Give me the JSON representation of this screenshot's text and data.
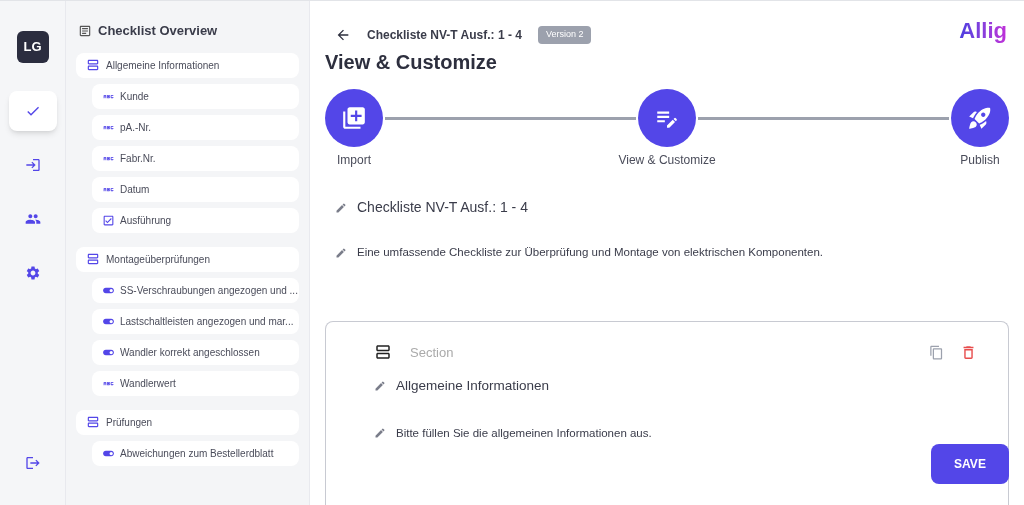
{
  "rail": {
    "avatar": "LG",
    "items": [
      {
        "kind": "checklists",
        "selected": true
      },
      {
        "kind": "import",
        "selected": false
      },
      {
        "kind": "users",
        "selected": false
      },
      {
        "kind": "settings",
        "selected": false
      }
    ],
    "logout": {
      "kind": "logout"
    }
  },
  "overview": {
    "title": "Checklist Overview",
    "sections": [
      {
        "label": "Allgemeine Informationen",
        "children": [
          {
            "kind": "text",
            "label": "Kunde"
          },
          {
            "kind": "text",
            "label": "pA.-Nr."
          },
          {
            "kind": "text",
            "label": "Fabr.Nr."
          },
          {
            "kind": "text",
            "label": "Datum"
          },
          {
            "kind": "checkbox",
            "label": "Ausführung"
          }
        ]
      },
      {
        "label": "Montageüberprüfungen",
        "children": [
          {
            "kind": "toggle",
            "label": "SS-Verschraubungen angezogen und ..."
          },
          {
            "kind": "toggle",
            "label": "Lastschaltleisten angezogen und mar..."
          },
          {
            "kind": "toggle",
            "label": "Wandler korrekt angeschlossen"
          },
          {
            "kind": "text",
            "label": "Wandlerwert"
          }
        ]
      },
      {
        "label": "Prüfungen",
        "children": [
          {
            "kind": "toggle",
            "label": "Abweichungen zum Bestellerdblatt"
          }
        ]
      }
    ]
  },
  "header": {
    "title": "Checkliste NV-T Ausf.: 1 - 4",
    "badge": "Version 2",
    "logo": "Allig",
    "heading": "View & Customize"
  },
  "steps": [
    {
      "kind": "import",
      "label": "Import"
    },
    {
      "kind": "customize",
      "label": "View & Customize"
    },
    {
      "kind": "publish",
      "label": "Publish"
    }
  ],
  "checklist": {
    "title": "Checkliste NV-T Ausf.: 1 - 4",
    "description": "Eine umfassende Checkliste zur Überprüfung und Montage von elektrischen Komponenten."
  },
  "section_card": {
    "placeholder": "Section",
    "title": "Allgemeine Informationen",
    "description": "Bitte füllen Sie die allgemeinen Informationen aus.",
    "save": "SAVE"
  }
}
